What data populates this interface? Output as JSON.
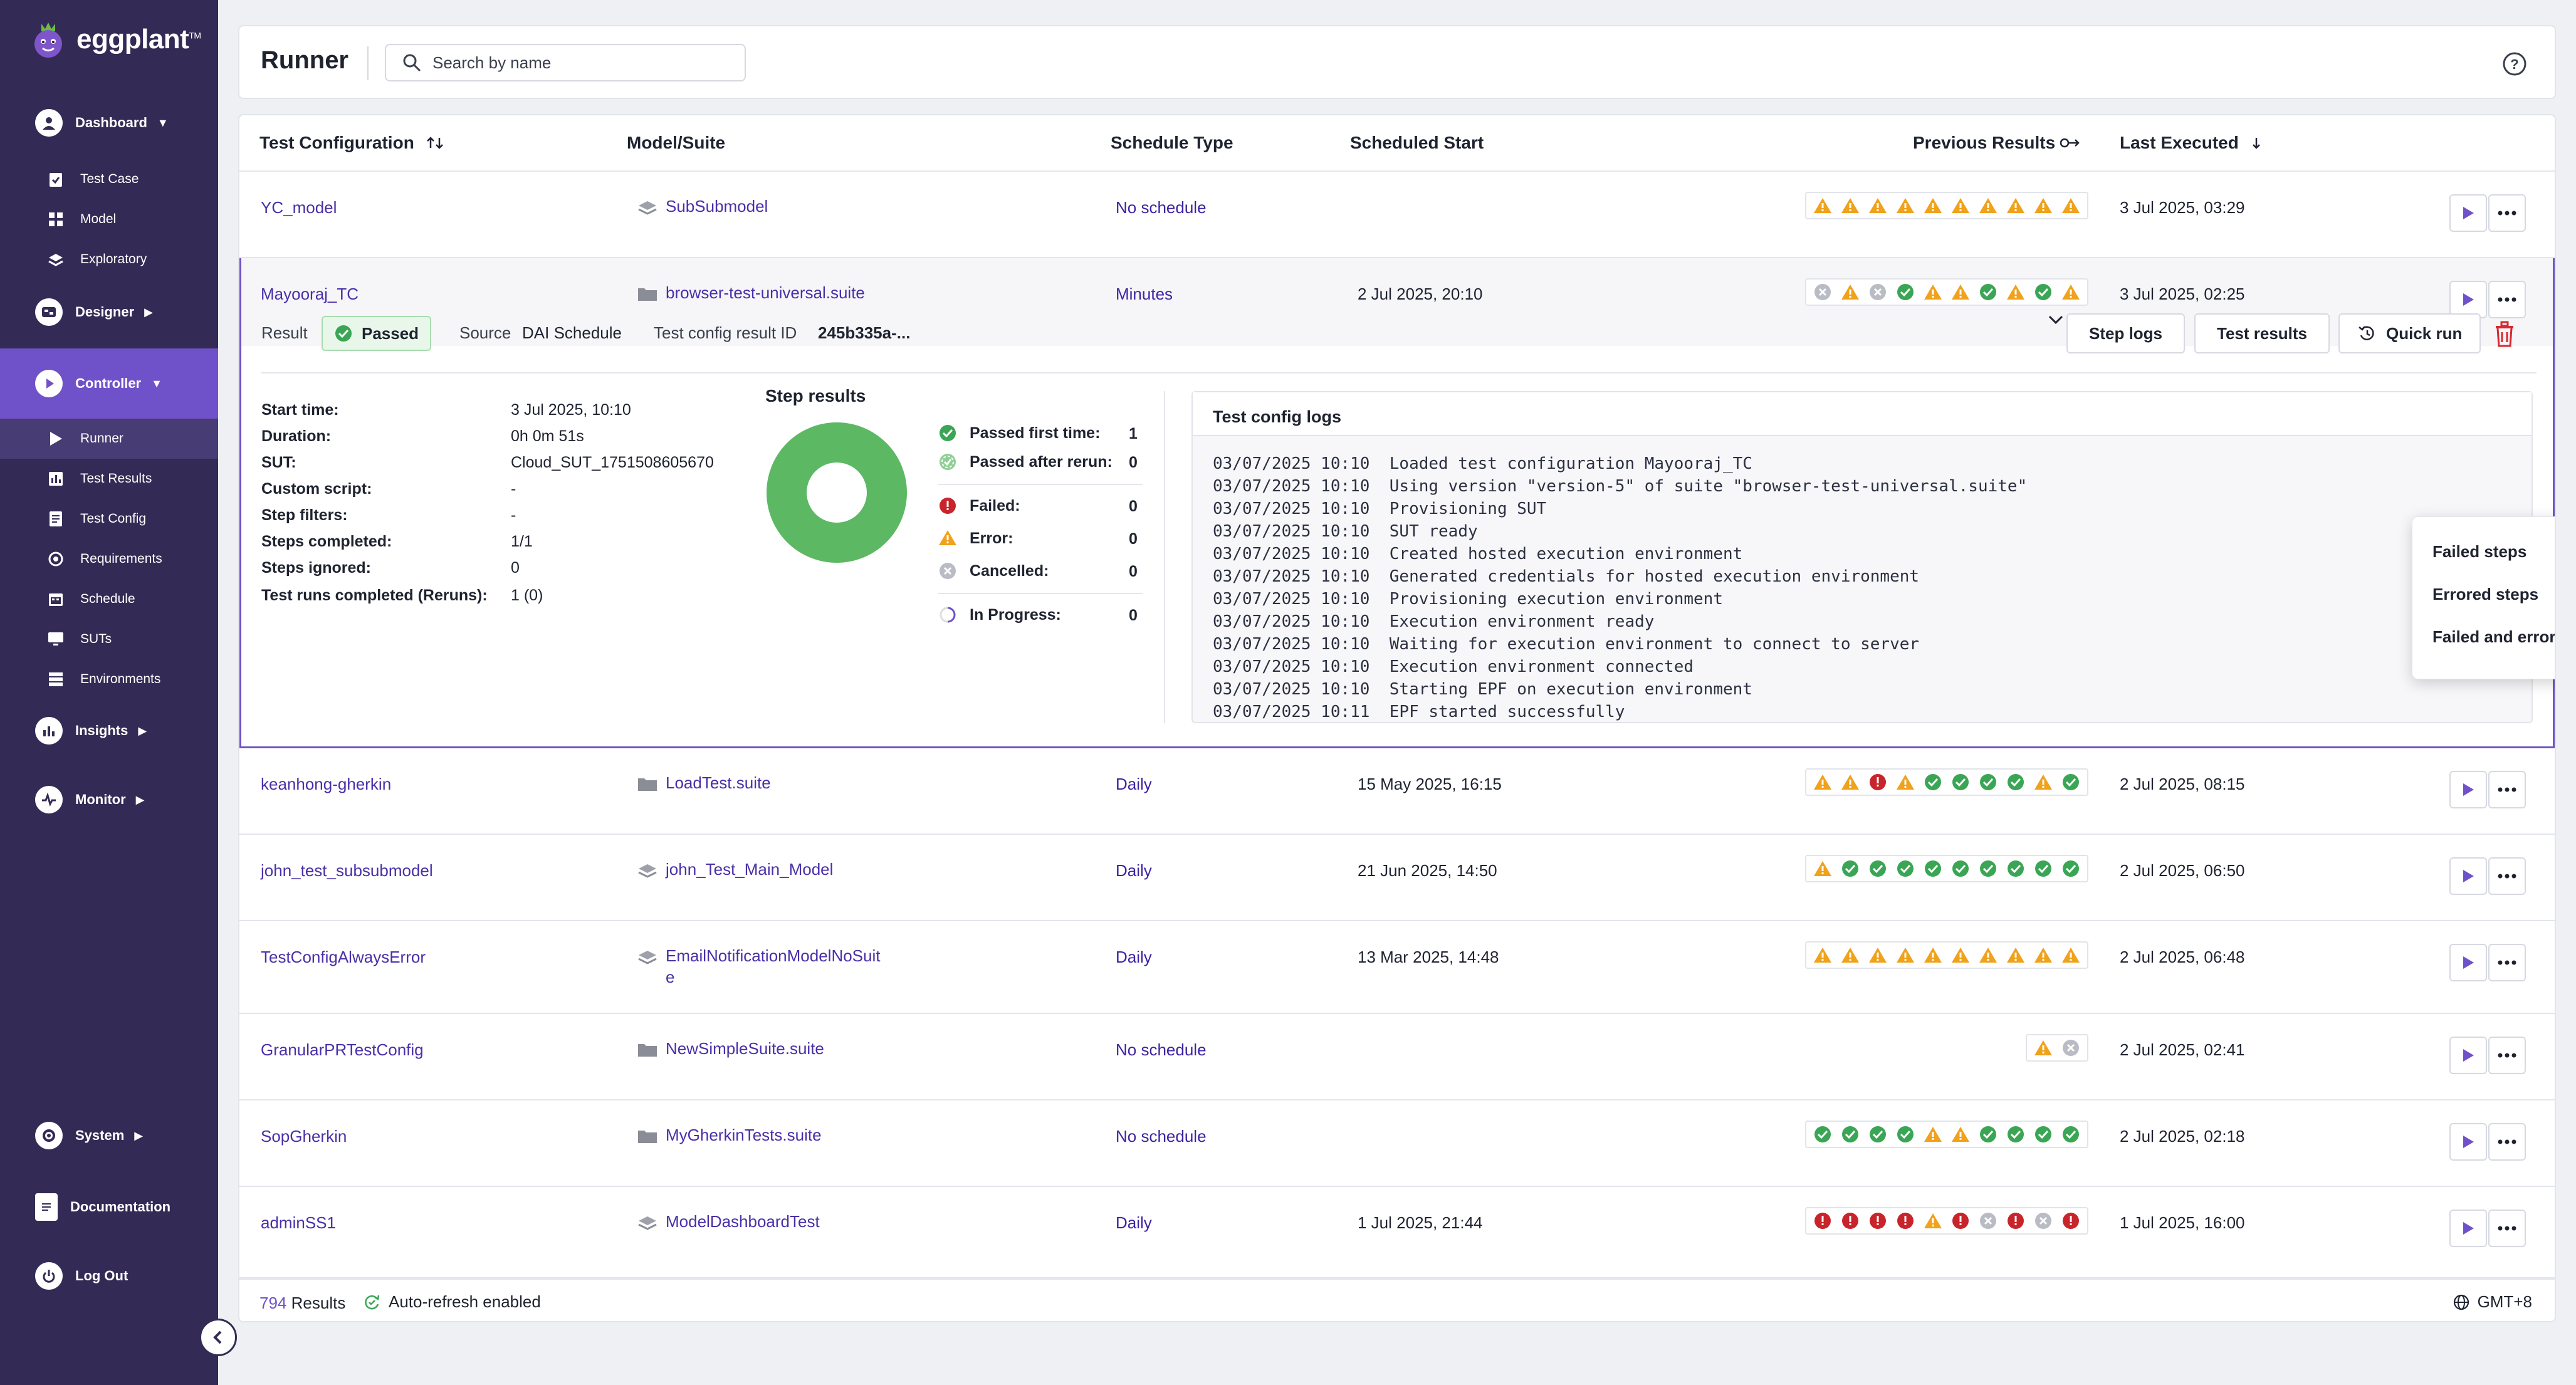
{
  "app": {
    "logo_text": "eggplant",
    "logo_tm": "TM"
  },
  "sidebar": {
    "dashboard": "Dashboard",
    "test_case": "Test Case",
    "model": "Model",
    "exploratory": "Exploratory",
    "designer": "Designer",
    "controller": "Controller",
    "runner": "Runner",
    "test_results": "Test Results",
    "test_config": "Test Config",
    "requirements": "Requirements",
    "schedule": "Schedule",
    "suts": "SUTs",
    "environments": "Environments",
    "insights": "Insights",
    "monitor": "Monitor",
    "system": "System",
    "documentation": "Documentation",
    "log_out": "Log Out"
  },
  "header": {
    "title": "Runner",
    "search_placeholder": "Search by name"
  },
  "columns": {
    "test_configuration": "Test Configuration",
    "model_suite": "Model/Suite",
    "schedule_type": "Schedule Type",
    "scheduled_start": "Scheduled Start",
    "previous_results": "Previous Results",
    "last_executed": "Last Executed"
  },
  "rows": [
    {
      "name": "YC_model",
      "suite": "SubSubmodel",
      "suite_type": "model",
      "schedule": "No schedule",
      "start": "",
      "results": [
        "w",
        "w",
        "w",
        "w",
        "w",
        "w",
        "w",
        "w",
        "w",
        "w"
      ],
      "last": "3 Jul 2025, 03:29"
    },
    {
      "name": "Mayooraj_TC",
      "suite": "browser-test-universal.suite",
      "suite_type": "folder",
      "schedule": "Minutes",
      "start": "2 Jul 2025, 20:10",
      "results": [
        "c",
        "w",
        "c",
        "p",
        "w",
        "w",
        "p",
        "w",
        "p",
        "w"
      ],
      "last": "3 Jul 2025, 02:25"
    },
    {
      "name": "keanhong-gherkin",
      "suite": "LoadTest.suite",
      "suite_type": "folder",
      "schedule": "Daily",
      "start": "15 May 2025, 16:15",
      "results": [
        "w",
        "w",
        "f",
        "w",
        "p",
        "p",
        "p",
        "p",
        "w",
        "p"
      ],
      "last": "2 Jul 2025, 08:15"
    },
    {
      "name": "john_test_subsubmodel",
      "suite": "john_Test_Main_Model",
      "suite_type": "model",
      "schedule": "Daily",
      "start": "21 Jun 2025, 14:50",
      "results": [
        "w",
        "p",
        "p",
        "p",
        "p",
        "p",
        "p",
        "p",
        "p",
        "p"
      ],
      "last": "2 Jul 2025, 06:50"
    },
    {
      "name": "TestConfigAlwaysError",
      "suite": "EmailNotificationModelNoSuit",
      "suite_2": "e",
      "suite_type": "model",
      "schedule": "Daily",
      "start": "13 Mar 2025, 14:48",
      "results": [
        "w",
        "w",
        "w",
        "w",
        "w",
        "w",
        "w",
        "w",
        "w",
        "w"
      ],
      "last": "2 Jul 2025, 06:48"
    },
    {
      "name": "GranularPRTestConfig",
      "suite": "NewSimpleSuite.suite",
      "suite_type": "folder",
      "schedule": "No schedule",
      "start": "",
      "results": [
        "w",
        "c"
      ],
      "last": "2 Jul 2025, 02:41"
    },
    {
      "name": "SopGherkin",
      "suite": "MyGherkinTests.suite",
      "suite_type": "folder",
      "schedule": "No schedule",
      "start": "",
      "results": [
        "p",
        "p",
        "p",
        "p",
        "w",
        "w",
        "p",
        "p",
        "p",
        "p"
      ],
      "last": "2 Jul 2025, 02:18"
    },
    {
      "name": "adminSS1",
      "suite": "ModelDashboardTest",
      "suite_type": "model",
      "schedule": "Daily",
      "start": "1 Jul 2025, 21:44",
      "results": [
        "f",
        "f",
        "f",
        "f",
        "w",
        "f",
        "c",
        "f",
        "c",
        "f"
      ],
      "last": "1 Jul 2025, 16:00"
    }
  ],
  "expanded": {
    "result_label": "Result",
    "result_value": "Passed",
    "source_label": "Source",
    "source_value": "DAI Schedule",
    "id_label": "Test config result ID",
    "id_value": "245b335a-...",
    "step_logs": "Step logs",
    "test_results": "Test results",
    "quick_run": "Quick run",
    "details": [
      {
        "label": "Start time:",
        "value": "3 Jul 2025, 10:10"
      },
      {
        "label": "Duration:",
        "value": "0h 0m 51s"
      },
      {
        "label": "SUT:",
        "value": "Cloud_SUT_1751508605670"
      },
      {
        "label": "Custom script:",
        "value": "-"
      },
      {
        "label": "Step filters:",
        "value": "-"
      },
      {
        "label": "Steps completed:",
        "value": "1/1"
      },
      {
        "label": "Steps ignored:",
        "value": "0"
      },
      {
        "label": "Test runs completed (Reruns):",
        "value": "1 (0)"
      }
    ],
    "step_results_title": "Step results",
    "step_results": [
      {
        "label": "Passed first time:",
        "value": "1",
        "kind": "p"
      },
      {
        "label": "Passed after rerun:",
        "value": "0",
        "kind": "pr"
      },
      {
        "label": "Failed:",
        "value": "0",
        "kind": "f"
      },
      {
        "label": "Error:",
        "value": "0",
        "kind": "w"
      },
      {
        "label": "Cancelled:",
        "value": "0",
        "kind": "c"
      },
      {
        "label": "In Progress:",
        "value": "0",
        "kind": "ip"
      }
    ],
    "logs_title": "Test config logs",
    "logs": [
      "03/07/2025 10:10  Loaded test configuration Mayooraj_TC",
      "03/07/2025 10:10  Using version \"version-5\" of suite \"browser-test-universal.suite\"",
      "03/07/2025 10:10  Provisioning SUT",
      "03/07/2025 10:10  SUT ready",
      "03/07/2025 10:10  Created hosted execution environment",
      "03/07/2025 10:10  Generated credentials for hosted execution environment",
      "03/07/2025 10:10  Provisioning execution environment",
      "03/07/2025 10:10  Execution environment ready",
      "03/07/2025 10:10  Waiting for execution environment to connect to server",
      "03/07/2025 10:10  Execution environment connected",
      "03/07/2025 10:10  Starting EPF on execution environment",
      "03/07/2025 10:11  EPF started successfully"
    ]
  },
  "dropdown": {
    "items": [
      "Failed steps",
      "Errored steps",
      "Failed and errored steps"
    ]
  },
  "footer": {
    "count": "794",
    "results_label": "Results",
    "auto_refresh": "Auto-refresh enabled",
    "timezone": "GMT+8"
  },
  "colors": {
    "sidebar": "#332b55",
    "accent": "#6f52c9",
    "pass": "#3aa655",
    "warn": "#f0a21b",
    "fail": "#c7252b",
    "cancel": "#b9bcc4"
  }
}
